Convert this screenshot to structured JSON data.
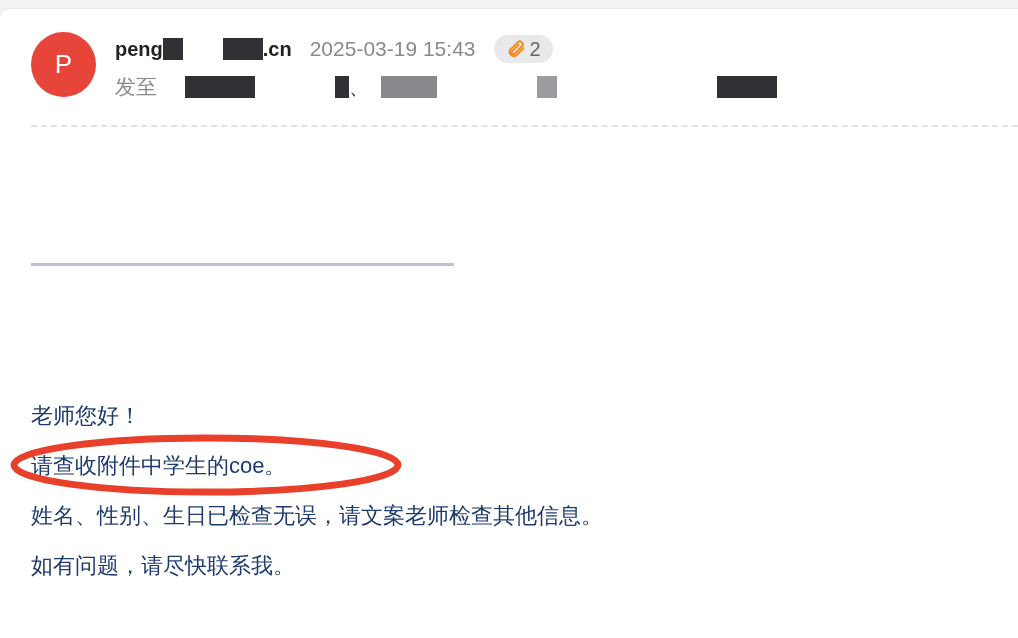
{
  "message": {
    "sender": {
      "avatar_letter": "P",
      "name_start": "peng",
      "name_end": ".cn"
    },
    "date": "2025-03-19 15:43",
    "attachments": {
      "count": "2"
    },
    "recipients": {
      "label": "发至",
      "separator": "、"
    },
    "body": [
      {
        "text": "老师您好！",
        "circled": false
      },
      {
        "text": "请查收附件中学生的coe。",
        "circled": true
      },
      {
        "text": "姓名、性别、生日已检查无误，请文案老师检查其他信息。",
        "circled": false
      },
      {
        "text": "如有问题，请尽快联系我。",
        "circled": false
      }
    ]
  }
}
